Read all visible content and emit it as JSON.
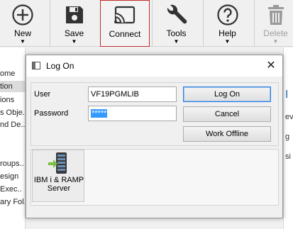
{
  "toolbar": {
    "items": [
      {
        "label": "New",
        "icon": "plus-circle-icon",
        "has_dropdown": true
      },
      {
        "label": "Save",
        "icon": "floppy-disk-icon",
        "has_dropdown": true
      },
      {
        "label": "Connect",
        "icon": "cast-icon",
        "has_dropdown": false,
        "active": true
      },
      {
        "label": "Tools",
        "icon": "wrench-icon",
        "has_dropdown": true
      },
      {
        "label": "Help",
        "icon": "question-circle-icon",
        "has_dropdown": true
      },
      {
        "label": "Delete",
        "icon": "trash-icon",
        "has_dropdown": true,
        "disabled": true
      }
    ],
    "caret": "▼"
  },
  "left_tree": {
    "items": [
      "ome",
      "tion",
      "ions",
      "s Obje..",
      "nd De..",
      "roups..",
      "esign",
      "Exec..",
      "ary Fol.."
    ]
  },
  "right_pane": {
    "items": [
      "I",
      "ev",
      "g",
      "si"
    ]
  },
  "dialog": {
    "title": "Log On",
    "close_glyph": "✕",
    "user_label": "User",
    "user_value": "VF19PGMLIB",
    "password_label": "Password",
    "password_value": "*****",
    "buttons": {
      "log_on": "Log On",
      "cancel": "Cancel",
      "work_offline": "Work Offline"
    },
    "app_tile": {
      "label": "IBM i & RAMP Server",
      "icon": "server-icon"
    }
  },
  "colors": {
    "active_border": "#c42b2b",
    "selection": "#3399ff",
    "default_button_border": "#2f7ad8",
    "server_green": "#7cc043"
  }
}
